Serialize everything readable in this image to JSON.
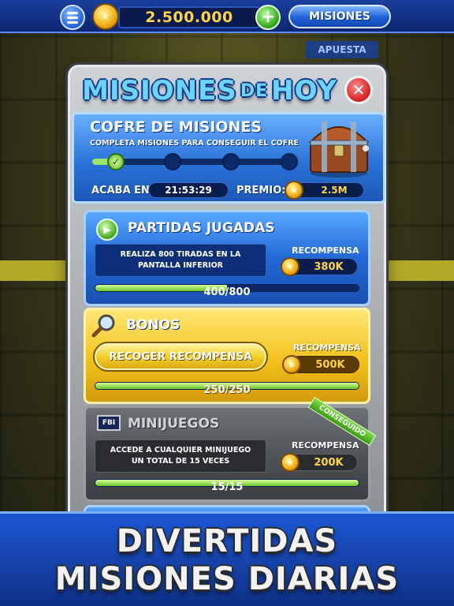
{
  "topbar": {
    "balance": "2.500.000",
    "plus_label": "+",
    "missions_label": "MISIONES"
  },
  "background": {
    "bet_tab_label": "APUESTA"
  },
  "panel": {
    "title_main": "MISIONES",
    "title_de": "DE",
    "title_end": "HOY",
    "close_label": "✕"
  },
  "chest": {
    "title": "COFRE DE MISIONES",
    "description": "COMPLETA MISIONES PARA CONSEGUIR EL COFRE",
    "steps_total": 4,
    "steps_done": 1,
    "ends_label": "ACABA EN:",
    "ends_value": "21:53:29",
    "prize_label": "PREMIO:",
    "prize_value": "2.5M"
  },
  "missions": [
    {
      "title": "PARTIDAS JUGADAS",
      "icon": "play-icon",
      "description": "REALIZA 800 TIRADAS EN LA PANTALLA INFERIOR",
      "reward_label": "RECOMPENSA",
      "reward_value": "380K",
      "progress_text": "400/800",
      "progress": 0.5
    },
    {
      "title": "BONOS",
      "icon": "magnifier-icon",
      "button_label": "RECOGER RECOMPENSA",
      "reward_label": "RECOMPENSA",
      "reward_value": "500K",
      "progress_text": "250/250",
      "progress": 1.0
    },
    {
      "title": "MINIJUEGOS",
      "icon": "fbi-badge-icon",
      "icon_text": "FBI",
      "badge": "CONSEGUIDO",
      "description": "ACCEDE A CUALQUIER MINIJUEGO UN TOTAL DE 15 VECES",
      "reward_label": "RECOMPENSA",
      "reward_value": "200K",
      "progress_text": "15/15",
      "progress": 1.0
    }
  ],
  "footer": {
    "line1": "DIVERTIDAS",
    "line2": "MISIONES DIARIAS"
  },
  "colors": {
    "accent_blue": "#2268d6",
    "gold": "#f2c21c",
    "coin_text": "#ffd34a",
    "progress_green": "#6bc22a"
  }
}
